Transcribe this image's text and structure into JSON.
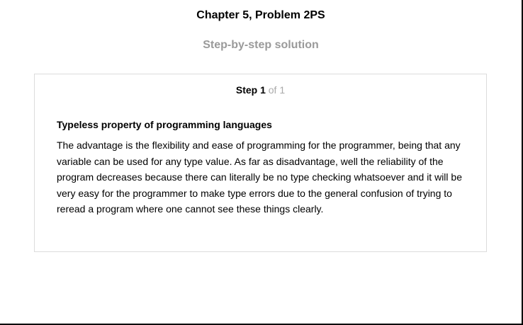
{
  "header": {
    "title": "Chapter 5, Problem 2PS",
    "subtitle": "Step-by-step solution"
  },
  "step": {
    "label": "Step 1",
    "total": "of 1"
  },
  "content": {
    "heading": "Typeless property of programming languages",
    "body": "The advantage is the flexibility and ease of programming for the programmer, being that any variable can be used for any type value. As far as disadvantage, well the reliability of the program decreases because there can literally be no type checking whatsoever and it will be very easy for the programmer to make type errors due to the general confusion of trying to reread a program where one cannot see these things clearly."
  },
  "colors": {
    "subtitle": "#9a9a9a",
    "step_total": "#a9a9a9",
    "card_border": "#dcdcdc"
  }
}
